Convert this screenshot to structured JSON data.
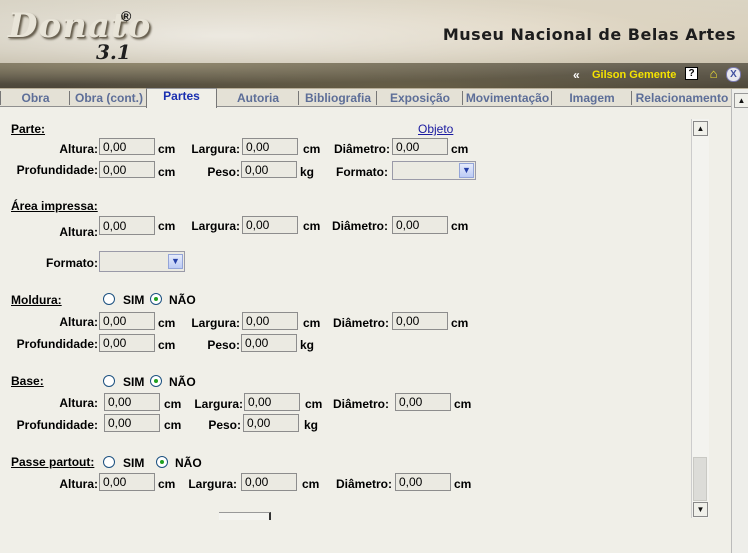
{
  "header": {
    "logo_text": "Donato",
    "logo_registered": "®",
    "logo_version": "3.1",
    "museum_title": "Museu Nacional de Belas Artes",
    "back_symbol": "«",
    "user_name": "Gilson Gemente",
    "help_symbol": "?",
    "home_symbol": "⌂",
    "close_symbol": "X"
  },
  "tabs": [
    {
      "label": "Obra"
    },
    {
      "label": "Obra (cont.)"
    },
    {
      "label": "Partes"
    },
    {
      "label": "Autoria"
    },
    {
      "label": "Bibliografia"
    },
    {
      "label": "Exposição"
    },
    {
      "label": "Movimentação"
    },
    {
      "label": "Imagem"
    },
    {
      "label": "Relacionamento"
    }
  ],
  "objeto_link": "Objeto",
  "sections": {
    "parte": {
      "title": "Parte:",
      "altura_label": "Altura:",
      "altura": "0,00",
      "altura_unit": "cm",
      "largura_label": "Largura:",
      "largura": "0,00",
      "largura_unit": "cm",
      "diametro_label": "Diâmetro:",
      "diametro": "0,00",
      "diametro_unit": "cm",
      "profundidade_label": "Profundidade:",
      "profundidade": "0,00",
      "profundidade_unit": "cm",
      "peso_label": "Peso:",
      "peso": "0,00",
      "peso_unit": "kg",
      "formato_label": "Formato:",
      "formato": ""
    },
    "area": {
      "title": "Área impressa:",
      "altura_label": "Altura:",
      "altura": "0,00",
      "altura_unit": "cm",
      "largura_label": "Largura:",
      "largura": "0,00",
      "largura_unit": "cm",
      "diametro_label": "Diâmetro:",
      "diametro": "0,00",
      "diametro_unit": "cm",
      "formato_label": "Formato:",
      "formato": ""
    },
    "moldura": {
      "title": "Moldura:",
      "sim": "SIM",
      "nao": "NÃO",
      "selected": "NÃO",
      "altura_label": "Altura:",
      "altura": "0,00",
      "altura_unit": "cm",
      "largura_label": "Largura:",
      "largura": "0,00",
      "largura_unit": "cm",
      "diametro_label": "Diâmetro:",
      "diametro": "0,00",
      "diametro_unit": "cm",
      "profundidade_label": "Profundidade:",
      "profundidade": "0,00",
      "profundidade_unit": "cm",
      "peso_label": "Peso:",
      "peso": "0,00",
      "peso_unit": "kg"
    },
    "base": {
      "title": "Base:",
      "sim": "SIM",
      "nao": "NÃO",
      "selected": "NÃO",
      "altura_label": "Altura:",
      "altura": "0,00",
      "altura_unit": "cm",
      "largura_label": "Largura:",
      "largura": "0,00",
      "largura_unit": "cm",
      "diametro_label": "Diâmetro:",
      "diametro": "0,00",
      "diametro_unit": "cm",
      "profundidade_label": "Profundidade:",
      "profundidade": "0,00",
      "profundidade_unit": "cm",
      "peso_label": "Peso:",
      "peso": "0,00",
      "peso_unit": "kg"
    },
    "passe": {
      "title": "Passe partout:",
      "sim": "SIM",
      "nao": "NÃO",
      "selected": "NÃO",
      "altura_label": "Altura:",
      "altura": "0,00",
      "altura_unit": "cm",
      "largura_label": "Largura:",
      "largura": "0,00",
      "largura_unit": "cm",
      "diametro_label": "Diâmetro:",
      "diametro": "0,00",
      "diametro_unit": "cm"
    }
  },
  "scroll": {
    "up_symbol": "▲",
    "down_symbol": "▼"
  },
  "colors": {
    "accent": "#1a2fb0",
    "tab_text": "#5d6e98",
    "user_name": "#f5e300",
    "field_bg": "#ebeae2"
  }
}
